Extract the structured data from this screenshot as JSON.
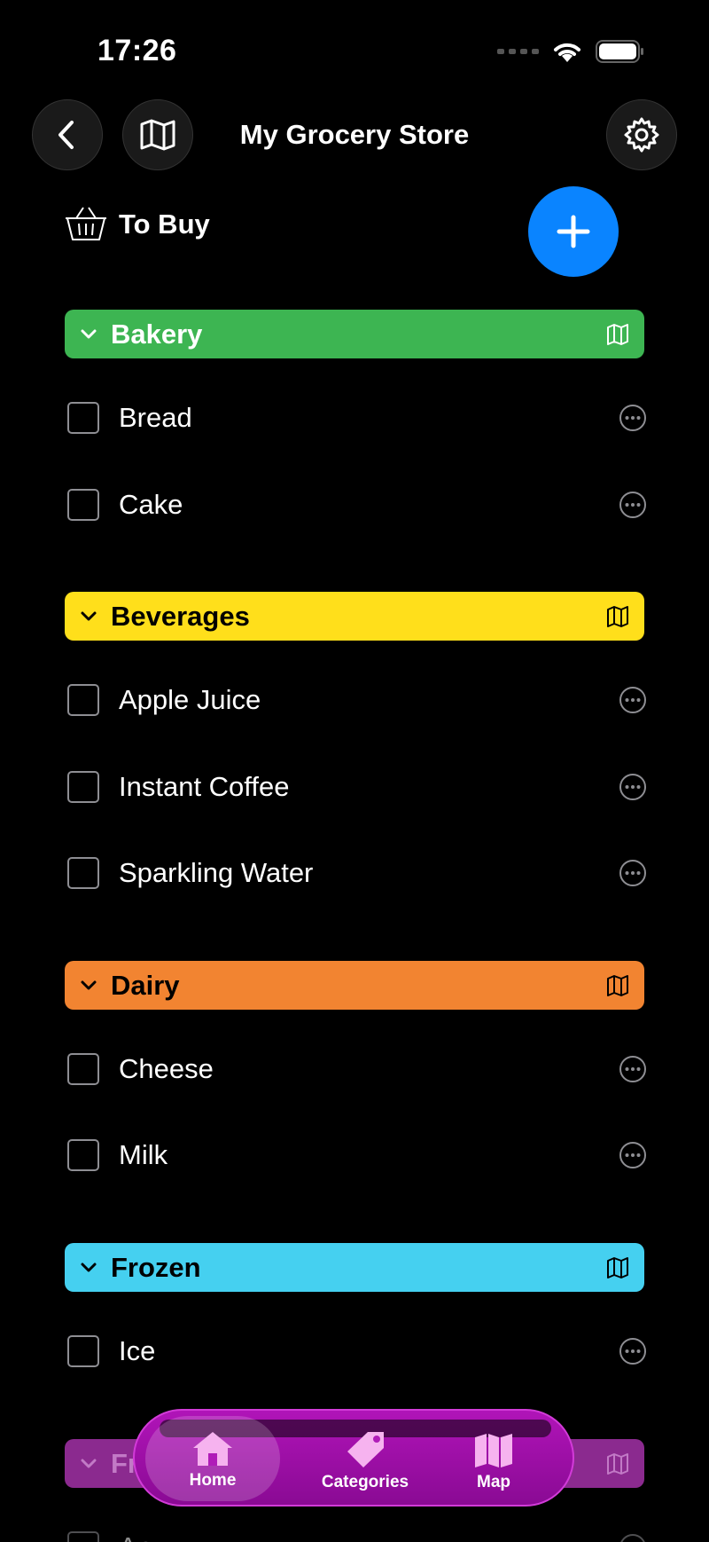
{
  "status": {
    "time": "17:26"
  },
  "nav": {
    "title": "My Grocery Store"
  },
  "to_buy": {
    "label": "To Buy"
  },
  "categories": [
    {
      "name": "Bakery",
      "color": "#3db552",
      "text_color": "#ffffff",
      "items": [
        "Bread",
        "Cake"
      ]
    },
    {
      "name": "Beverages",
      "color": "#ffdf1b",
      "text_color": "#000000",
      "items": [
        "Apple Juice",
        "Instant Coffee",
        "Sparkling Water"
      ]
    },
    {
      "name": "Dairy",
      "color": "#f28431",
      "text_color": "#000000",
      "items": [
        "Cheese",
        "Milk"
      ]
    },
    {
      "name": "Frozen",
      "color": "#45d0f0",
      "text_color": "#000000",
      "items": [
        "Ice"
      ]
    },
    {
      "name": "Fr",
      "color": "#8b2a8f",
      "text_color": "#c27ac6",
      "items": [
        "Ap"
      ]
    }
  ],
  "tabs": [
    {
      "label": "Home",
      "icon": "house-icon"
    },
    {
      "label": "Categories",
      "icon": "tag-icon"
    },
    {
      "label": "Map",
      "icon": "map-icon"
    }
  ],
  "colors": {
    "accent": "#0a84ff",
    "tab_bar": "#a010aa"
  }
}
